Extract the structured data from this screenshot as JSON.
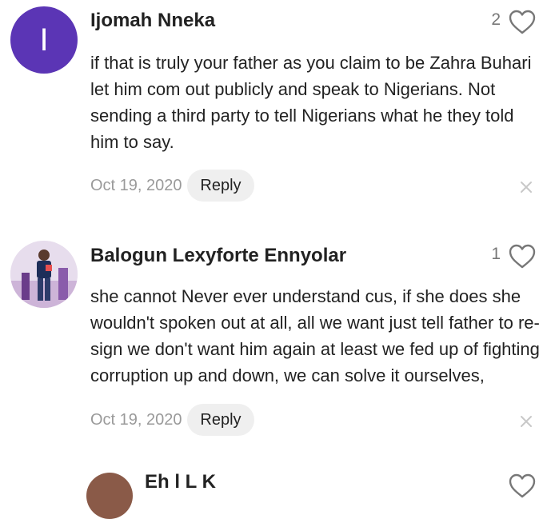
{
  "comments": [
    {
      "avatar_letter": "I",
      "avatar_color": "#5b35b5",
      "author": "Ijomah Nneka",
      "likes": "2",
      "lines": [
        "if that is truly your father as you claim to be Zahra Buhari",
        "let him com out publicly and speak to Nigerians. Not",
        "sending a third party to tell Nigerians what he they told",
        "him to say."
      ],
      "date": "Oct 19, 2020",
      "reply_label": "Reply"
    },
    {
      "avatar_image": "user-photo",
      "author": "Balogun Lexyforte Ennyolar",
      "likes": "1",
      "lines": [
        "she cannot Never ever understand cus, if she does she",
        "wouldn't spoken out at all, all we want just tell father to re-",
        "sign we don't want him again at least we fed up of fighting",
        "corruption up and down, we can solve it ourselves,"
      ],
      "date": "Oct 19, 2020",
      "reply_label": "Reply"
    },
    {
      "author": "Eh   l  L  K"
    }
  ],
  "icons": {
    "like": "heart-outline-icon",
    "dismiss": "close-icon"
  }
}
